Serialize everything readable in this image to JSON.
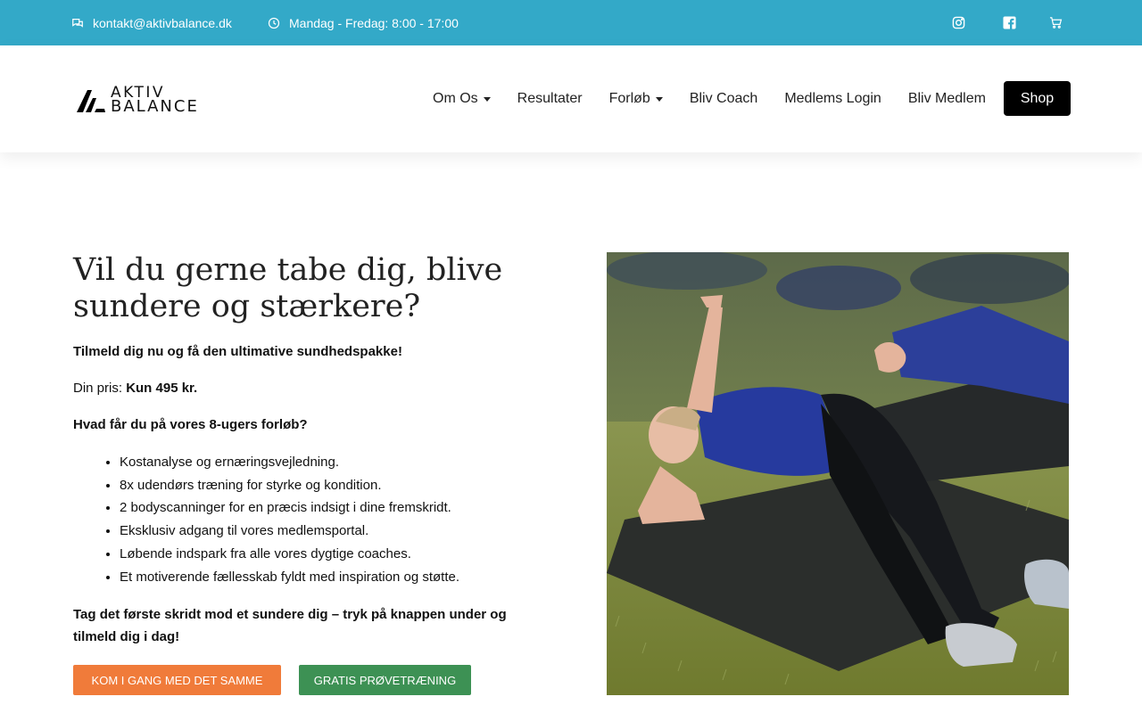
{
  "topbar": {
    "email": "kontakt@aktivbalance.dk",
    "hours": "Mandag - Fredag: 8:00 - 17:00",
    "background": "#33a9c8"
  },
  "logo": {
    "line1": "AKTIV",
    "line2": "BALANCE"
  },
  "nav": {
    "items": [
      {
        "label": "Om Os",
        "has_dropdown": true
      },
      {
        "label": "Resultater",
        "has_dropdown": false
      },
      {
        "label": "Forløb",
        "has_dropdown": true
      },
      {
        "label": "Bliv Coach",
        "has_dropdown": false
      },
      {
        "label": "Medlems Login",
        "has_dropdown": false
      },
      {
        "label": "Bliv Medlem",
        "has_dropdown": false
      }
    ],
    "shop_label": "Shop"
  },
  "hero": {
    "title": "Vil du gerne tabe dig, blive sundere og stærkere?",
    "subtitle": "Tilmeld dig nu og få den ultimative sundhedspakke!",
    "price_label": "Din pris: ",
    "price_value": "Kun 495 kr.",
    "question": "Hvad får du på vores 8-ugers forløb?",
    "benefits": [
      "Kostanalyse og ernæringsvejledning.",
      "8x udendørs træning for styrke og kondition.",
      "2 bodyscanninger for en præcis indsigt i dine fremskridt.",
      "Eksklusiv adgang til vores medlemsportal.",
      "Løbende indspark fra alle vores dygtige coaches.",
      "Et motiverende fællesskab fyldt med inspiration og støtte."
    ],
    "cta_text": "Tag det første skridt mod et sundere dig – tryk på knappen under og tilmeld dig i dag!",
    "primary_button": "KOM I GANG MED DET SAMME",
    "secondary_button": "GRATIS PRØVETRÆNING"
  },
  "colors": {
    "accent_orange": "#f07b3a",
    "accent_green": "#3d9154",
    "topbar_blue": "#33a9c8"
  }
}
